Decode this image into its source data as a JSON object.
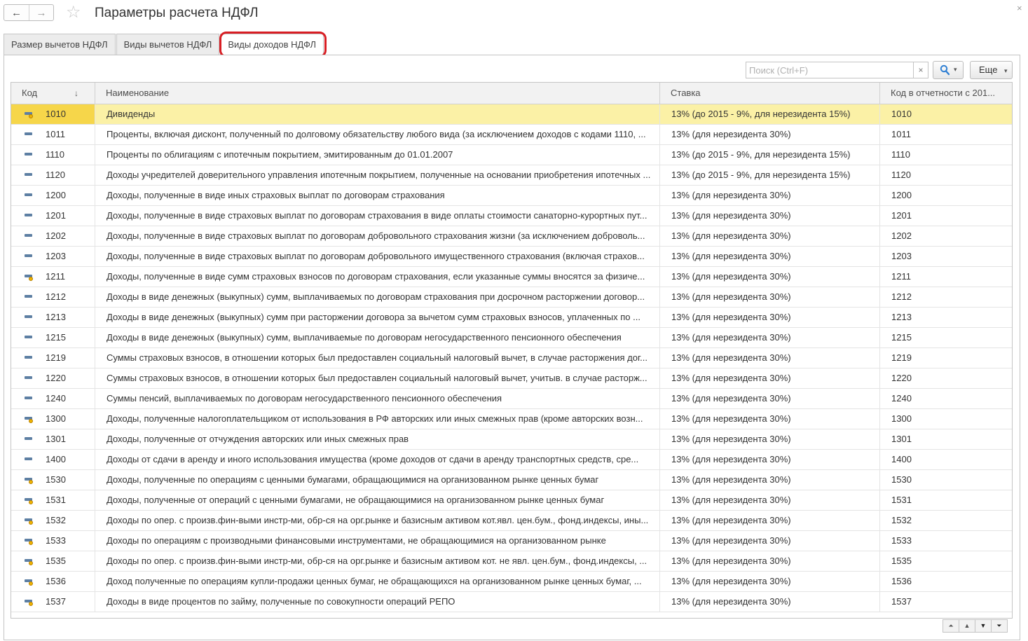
{
  "window": {
    "title": "Параметры расчета НДФЛ",
    "back_icon": "←",
    "forward_icon": "→",
    "star_icon": "☆",
    "close_icon": "×"
  },
  "tabs": [
    {
      "label": "Размер вычетов НДФЛ",
      "active": false
    },
    {
      "label": "Виды вычетов НДФЛ",
      "active": false
    },
    {
      "label": "Виды доходов НДФЛ",
      "active": true
    }
  ],
  "toolbar": {
    "search_placeholder": "Поиск (Ctrl+F)",
    "search_value": "",
    "clear_icon": "×",
    "more_label": "Еще",
    "caret_icon": "▾"
  },
  "table": {
    "columns": {
      "code": "Код",
      "name": "Наименование",
      "rate": "Ставка",
      "report_code": "Код в отчетности  с 201..."
    },
    "sort_icon": "↓",
    "selected_row": 0,
    "rows": [
      {
        "icon": "item-with-marker",
        "code": "1010",
        "name": "Дивиденды",
        "rate": "13% (до 2015 - 9%, для нерезидента 15%)",
        "report_code": "1010"
      },
      {
        "icon": "item",
        "code": "1011",
        "name": "Проценты, включая дисконт, полученный по долговому обязательству любого вида (за исключением доходов с кодами 1110, ...",
        "rate": "13% (для нерезидента 30%)",
        "report_code": "1011"
      },
      {
        "icon": "item",
        "code": "1110",
        "name": "Проценты по облигациям с ипотечным покрытием, эмитированным до 01.01.2007",
        "rate": "13% (до 2015 - 9%, для нерезидента 15%)",
        "report_code": "1110"
      },
      {
        "icon": "item",
        "code": "1120",
        "name": "Доходы учредителей доверительного управления ипотечным покрытием, полученные на основании приобретения ипотечных ...",
        "rate": "13% (до 2015 - 9%, для нерезидента 15%)",
        "report_code": "1120"
      },
      {
        "icon": "item",
        "code": "1200",
        "name": "Доходы, полученные в виде иных страховых выплат по договорам страхования",
        "rate": "13% (для нерезидента 30%)",
        "report_code": "1200"
      },
      {
        "icon": "item",
        "code": "1201",
        "name": "Доходы, полученные в виде страховых выплат по договорам страхования в виде оплаты стоимости санаторно-курортных пут...",
        "rate": "13% (для нерезидента 30%)",
        "report_code": "1201"
      },
      {
        "icon": "item",
        "code": "1202",
        "name": "Доходы, полученные в виде страховых выплат по договорам добровольного страхования жизни (за исключением доброволь...",
        "rate": "13% (для нерезидента 30%)",
        "report_code": "1202"
      },
      {
        "icon": "item",
        "code": "1203",
        "name": "Доходы, полученные в виде страховых выплат по договорам добровольного имущественного страхования (включая страхов...",
        "rate": "13% (для нерезидента 30%)",
        "report_code": "1203"
      },
      {
        "icon": "item-with-marker",
        "code": "1211",
        "name": "Доходы, полученные в виде сумм страховых взносов по договорам страхования, если указанные суммы вносятся за физиче...",
        "rate": "13% (для нерезидента 30%)",
        "report_code": "1211"
      },
      {
        "icon": "item",
        "code": "1212",
        "name": "Доходы в виде денежных (выкупных) сумм, выплачиваемых по договорам страхования при досрочном расторжении договор...",
        "rate": "13% (для нерезидента 30%)",
        "report_code": "1212"
      },
      {
        "icon": "item",
        "code": "1213",
        "name": "Доходы в виде денежных (выкупных) сумм при расторжении договора за вычетом сумм страховых взносов, уплаченных по ...",
        "rate": "13% (для нерезидента 30%)",
        "report_code": "1213"
      },
      {
        "icon": "item",
        "code": "1215",
        "name": "Доходы в виде денежных (выкупных) сумм, выплачиваемые по договорам негосударственного пенсионного обеспечения",
        "rate": "13% (для нерезидента 30%)",
        "report_code": "1215"
      },
      {
        "icon": "item",
        "code": "1219",
        "name": "Суммы страховых взносов, в отношении которых был предоставлен социальный налоговый вычет, в случае расторжения дог...",
        "rate": "13% (для нерезидента 30%)",
        "report_code": "1219"
      },
      {
        "icon": "item",
        "code": "1220",
        "name": "Суммы страховых взносов, в отношении которых был предоставлен социальный налоговый вычет, учитыв. в случае расторж...",
        "rate": "13% (для нерезидента 30%)",
        "report_code": "1220"
      },
      {
        "icon": "item",
        "code": "1240",
        "name": "Суммы пенсий, выплачиваемых по договорам негосударственного пенсионного обеспечения",
        "rate": "13% (для нерезидента 30%)",
        "report_code": "1240"
      },
      {
        "icon": "item-with-marker",
        "code": "1300",
        "name": "Доходы, полученные налогоплательщиком от использования в РФ авторских или иных смежных прав (кроме авторских возн...",
        "rate": "13% (для нерезидента 30%)",
        "report_code": "1300"
      },
      {
        "icon": "item",
        "code": "1301",
        "name": "Доходы, полученные от отчуждения авторских или иных смежных прав",
        "rate": "13% (для нерезидента 30%)",
        "report_code": "1301"
      },
      {
        "icon": "item",
        "code": "1400",
        "name": "Доходы от сдачи в аренду и иного использования имущества (кроме доходов от сдачи в аренду транспортных средств, сре...",
        "rate": "13% (для нерезидента 30%)",
        "report_code": "1400"
      },
      {
        "icon": "item-with-marker",
        "code": "1530",
        "name": "Доходы, полученные по операциям с ценными бумагами, обращающимися на организованном рынке ценных бумаг",
        "rate": "13% (для нерезидента 30%)",
        "report_code": "1530"
      },
      {
        "icon": "item-with-marker",
        "code": "1531",
        "name": "Доходы, полученные от операций с ценными бумагами, не обращающимися  на  организованном  рынке  ценных бумаг",
        "rate": "13% (для нерезидента 30%)",
        "report_code": "1531"
      },
      {
        "icon": "item-with-marker",
        "code": "1532",
        "name": "Доходы по опер. с произв.фин-выми инстр-ми, обр-ся на орг.рынке и базисным активом кот.явл. цен.бум., фонд.индексы, ины...",
        "rate": "13% (для нерезидента 30%)",
        "report_code": "1532"
      },
      {
        "icon": "item-with-marker",
        "code": "1533",
        "name": "Доходы по операциям с производными финансовыми инструментами, не обращающимися на организованном рынке",
        "rate": "13% (для нерезидента 30%)",
        "report_code": "1533"
      },
      {
        "icon": "item-with-marker",
        "code": "1535",
        "name": "Доходы по опер. с произв.фин-выми инстр-ми, обр-ся на орг.рынке и базисным активом кот. не явл. цен.бум., фонд.индексы, ...",
        "rate": "13% (для нерезидента 30%)",
        "report_code": "1535"
      },
      {
        "icon": "item-with-marker",
        "code": "1536",
        "name": "Доход полученные по операциям купли-продажи ценных бумаг, не обращающихся на организованном рынке ценных бумаг, ...",
        "rate": "13% (для нерезидента 30%)",
        "report_code": "1536"
      },
      {
        "icon": "item-with-marker",
        "code": "1537",
        "name": "Доходы в виде процентов по займу, полученные по совокупности операций РЕПО",
        "rate": "13% (для нерезидента 30%)",
        "report_code": "1537"
      }
    ]
  },
  "scroll_controls": [
    "⏶",
    "▲",
    "▼",
    "⏷"
  ],
  "colors": {
    "selected_row": "#fbf1a6",
    "selected_code_cell": "#f6d64a",
    "highlight_frame": "#d81e24",
    "search_icon": "#2f7fd3"
  }
}
